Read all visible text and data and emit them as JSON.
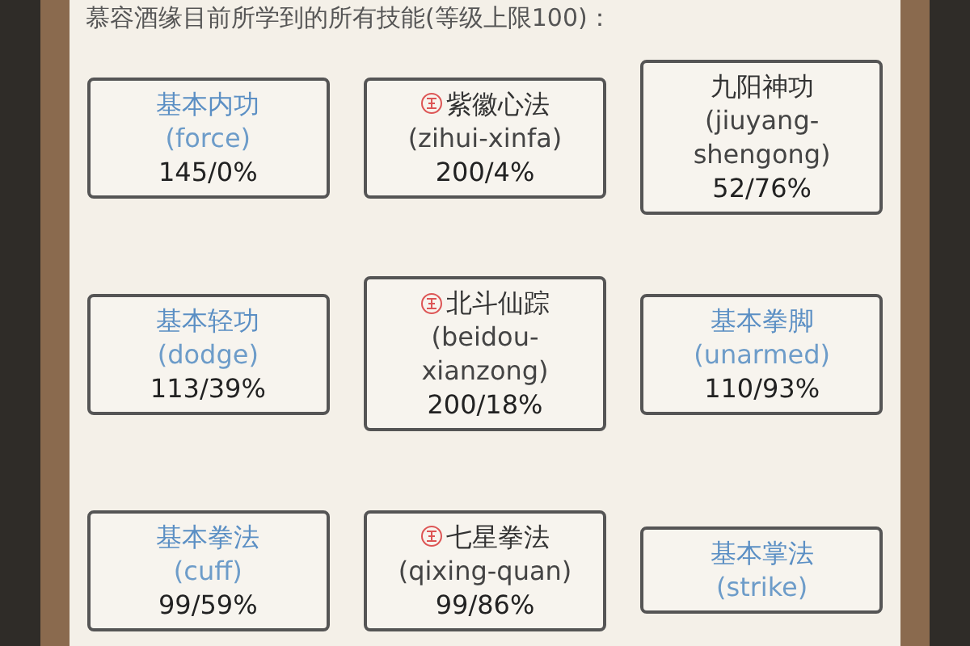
{
  "header": "慕容酒缘目前所学到的所有技能(等级上限100)：",
  "skills": [
    {
      "kind": "basic",
      "name": "基本内功",
      "id_text": "(force)",
      "value": "145/0%"
    },
    {
      "kind": "special",
      "name": "紫徽心法",
      "id_text": "(zihui-xinfa)",
      "value": "200/4%"
    },
    {
      "kind": "plain",
      "name": "九阳神功",
      "id_text": "(jiuyang-shengong)",
      "value": "52/76%"
    },
    {
      "kind": "basic",
      "name": "基本轻功",
      "id_text": "(dodge)",
      "value": "113/39%"
    },
    {
      "kind": "special",
      "name": "北斗仙踪",
      "id_text": "(beidou-xianzong)",
      "value": "200/18%"
    },
    {
      "kind": "basic",
      "name": "基本拳脚",
      "id_text": "(unarmed)",
      "value": "110/93%"
    },
    {
      "kind": "basic",
      "name": "基本拳法",
      "id_text": "(cuff)",
      "value": "99/59%"
    },
    {
      "kind": "special",
      "name": "七星拳法",
      "id_text": "(qixing-quan)",
      "value": "99/86%"
    },
    {
      "kind": "basic",
      "name": "基本掌法",
      "id_text": "(strike)"
    }
  ]
}
